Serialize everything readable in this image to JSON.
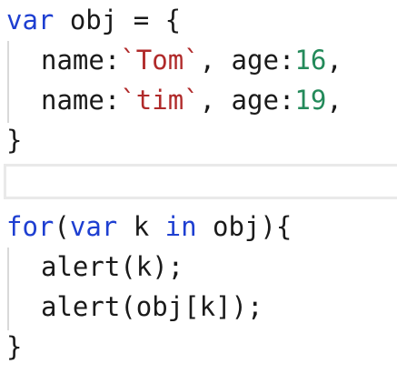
{
  "code_blocks": [
    {
      "lines": [
        {
          "kw": "var",
          "rest": " obj = {"
        },
        {
          "key1": "name:",
          "str1": "`Tom`",
          "sep": ", ",
          "key2": "age:",
          "num": "16",
          "end": ","
        },
        {
          "key1": "name:",
          "str1": "`tim`",
          "sep": ", ",
          "key2": "age:",
          "num": "19",
          "end": ","
        },
        {
          "text": "}"
        }
      ]
    },
    {
      "lines": [
        {
          "kw1": "for",
          "p1": "(",
          "kw2": "var",
          "p2": " k ",
          "kw3": "in",
          "p3": " obj){"
        },
        {
          "text": "alert(k);"
        },
        {
          "text": "alert(obj[k]);"
        },
        {
          "text": "}"
        }
      ]
    }
  ],
  "colors": {
    "keyword": "#1e3fd1",
    "string": "#b02a2a",
    "number": "#238a5a",
    "text": "#1a1a1a",
    "panel_border": "#e9e9e9",
    "indent_guide": "#d9d9d9"
  }
}
